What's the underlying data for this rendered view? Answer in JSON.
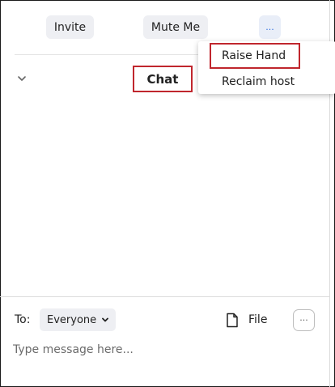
{
  "toolbar": {
    "invite_label": "Invite",
    "mute_label": "Mute Me",
    "more_label": "..."
  },
  "more_menu": {
    "items": [
      {
        "label": "Raise Hand"
      },
      {
        "label": "Reclaim host"
      }
    ]
  },
  "chat": {
    "title": "Chat",
    "to_label": "To:",
    "recipient": "Everyone",
    "file_label": "File",
    "more_label": "···",
    "placeholder": "Type message here..."
  },
  "colors": {
    "highlight_border": "#c0262d",
    "button_bg": "#eeeff3",
    "more_button_text": "#2d6cdf"
  },
  "icons": {
    "collapse": "chevron-down-icon",
    "recipient_caret": "caret-down-icon",
    "file": "file-icon",
    "more": "ellipsis-icon"
  }
}
